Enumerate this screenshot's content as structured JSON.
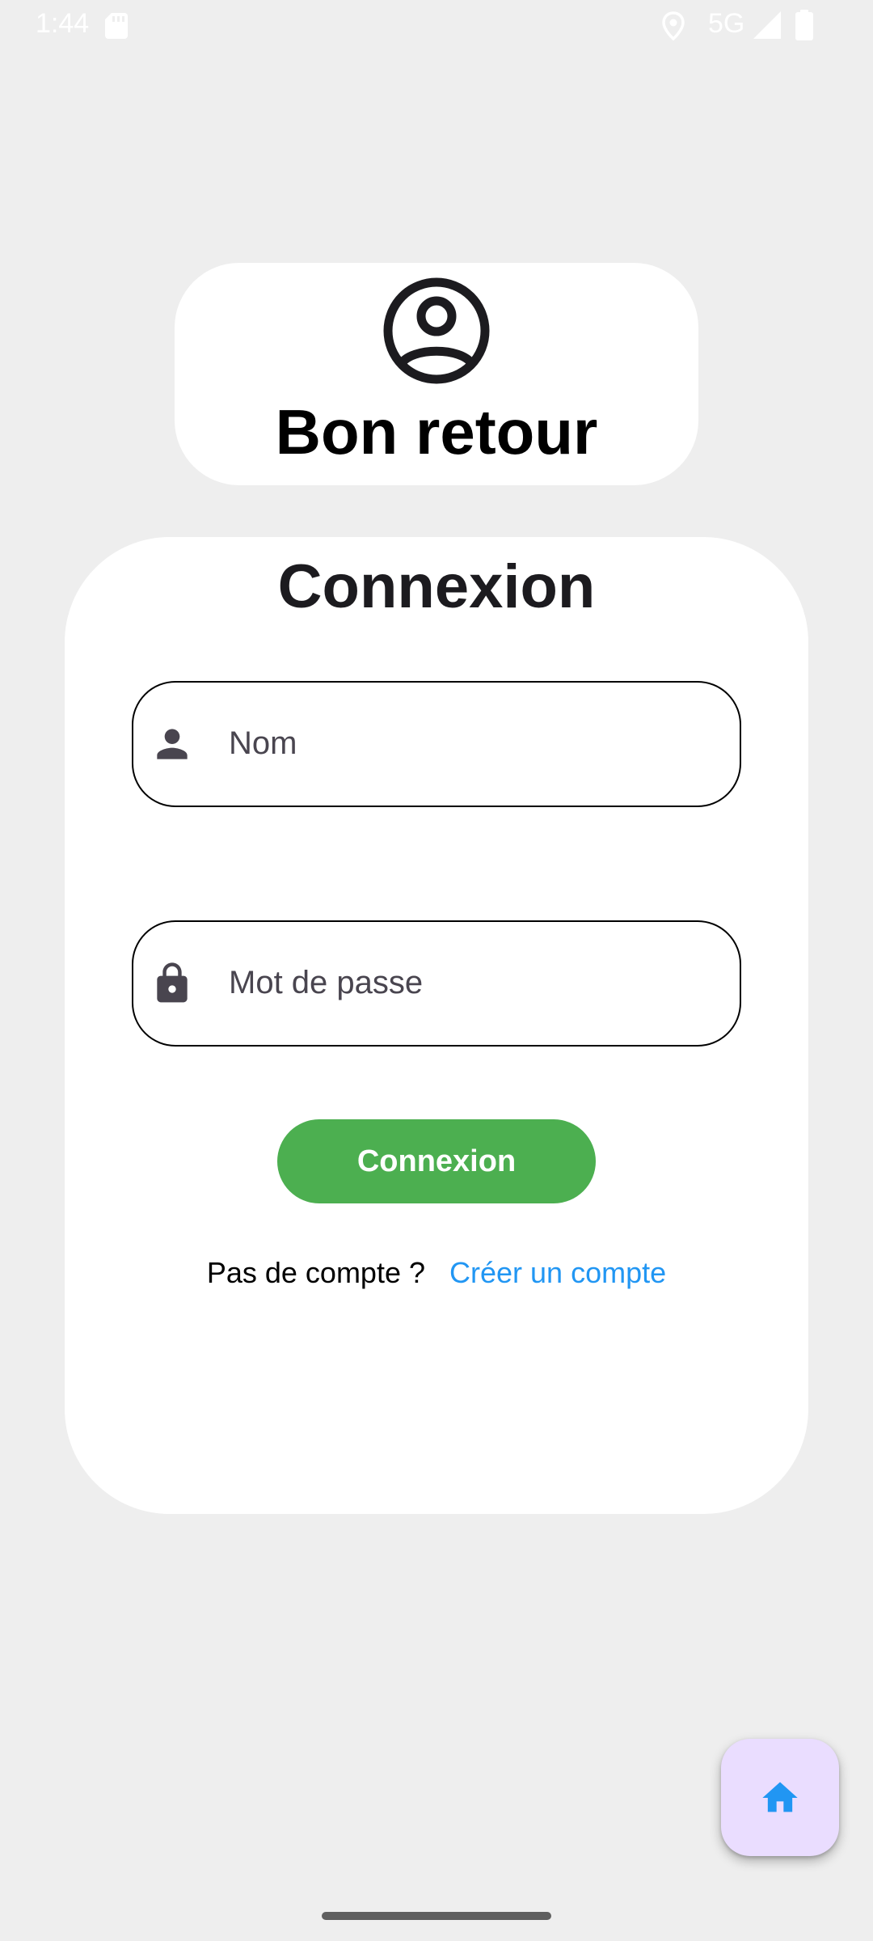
{
  "status_bar": {
    "time": "1:44",
    "network": "5G",
    "icons": [
      "sd-card-icon",
      "location-icon",
      "signal-icon",
      "battery-icon"
    ]
  },
  "welcome": {
    "icon": "account-circle-icon",
    "title": "Bon retour"
  },
  "login": {
    "title": "Connexion",
    "name_field": {
      "icon": "person-icon",
      "placeholder": "Nom",
      "value": ""
    },
    "password_field": {
      "icon": "lock-icon",
      "placeholder": "Mot de passe",
      "value": ""
    },
    "submit_label": "Connexion",
    "no_account_text": "Pas de compte ?",
    "signup_link": "Créer un compte"
  },
  "fab": {
    "icon": "home-icon"
  },
  "colors": {
    "background": "#eeeeee",
    "card": "#ffffff",
    "primary_button": "#4caf50",
    "link": "#2196f3",
    "fab_background": "#eaddff"
  }
}
